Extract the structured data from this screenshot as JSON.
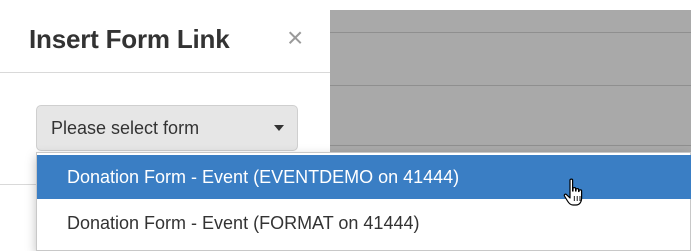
{
  "dialog": {
    "title": "Insert Form Link",
    "close_glyph": "×",
    "close_icon": "close-icon"
  },
  "form_select": {
    "selected_label": "Please select form",
    "caret_icon": "caret-down-icon",
    "options": [
      {
        "label": "Donation Form - Event (EVENTDEMO on 41444)",
        "highlighted": true
      },
      {
        "label": "Donation Form - Event (FORMAT on 41444)",
        "highlighted": false
      }
    ]
  },
  "colors": {
    "highlight": "#3a7ec4",
    "backdrop": "#a9a9a9"
  },
  "cursor": {
    "icon": "hand-pointer-icon"
  }
}
